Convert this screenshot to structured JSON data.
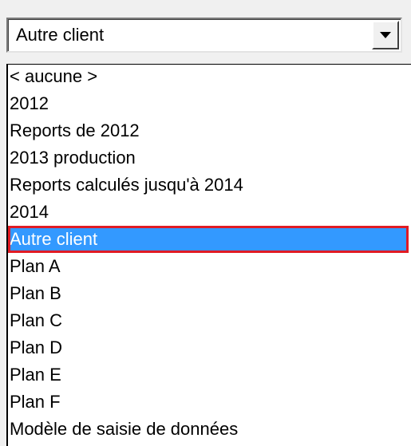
{
  "combo": {
    "value": "Autre client",
    "button_icon": "chevron-down-icon"
  },
  "dropdown": {
    "selected_index": 6,
    "items": [
      {
        "label": "<  aucune  >"
      },
      {
        "label": "2012"
      },
      {
        "label": "Reports de 2012"
      },
      {
        "label": "2013 production"
      },
      {
        "label": "Reports calculés jusqu'à 2014"
      },
      {
        "label": "2014"
      },
      {
        "label": "Autre client"
      },
      {
        "label": "Plan A"
      },
      {
        "label": "Plan B"
      },
      {
        "label": "Plan C"
      },
      {
        "label": "Plan D"
      },
      {
        "label": "Plan E"
      },
      {
        "label": "Plan F"
      },
      {
        "label": "Modèle de saisie de données"
      }
    ]
  },
  "colors": {
    "selection_background": "#3399ff",
    "highlight_border": "#e01b24"
  }
}
